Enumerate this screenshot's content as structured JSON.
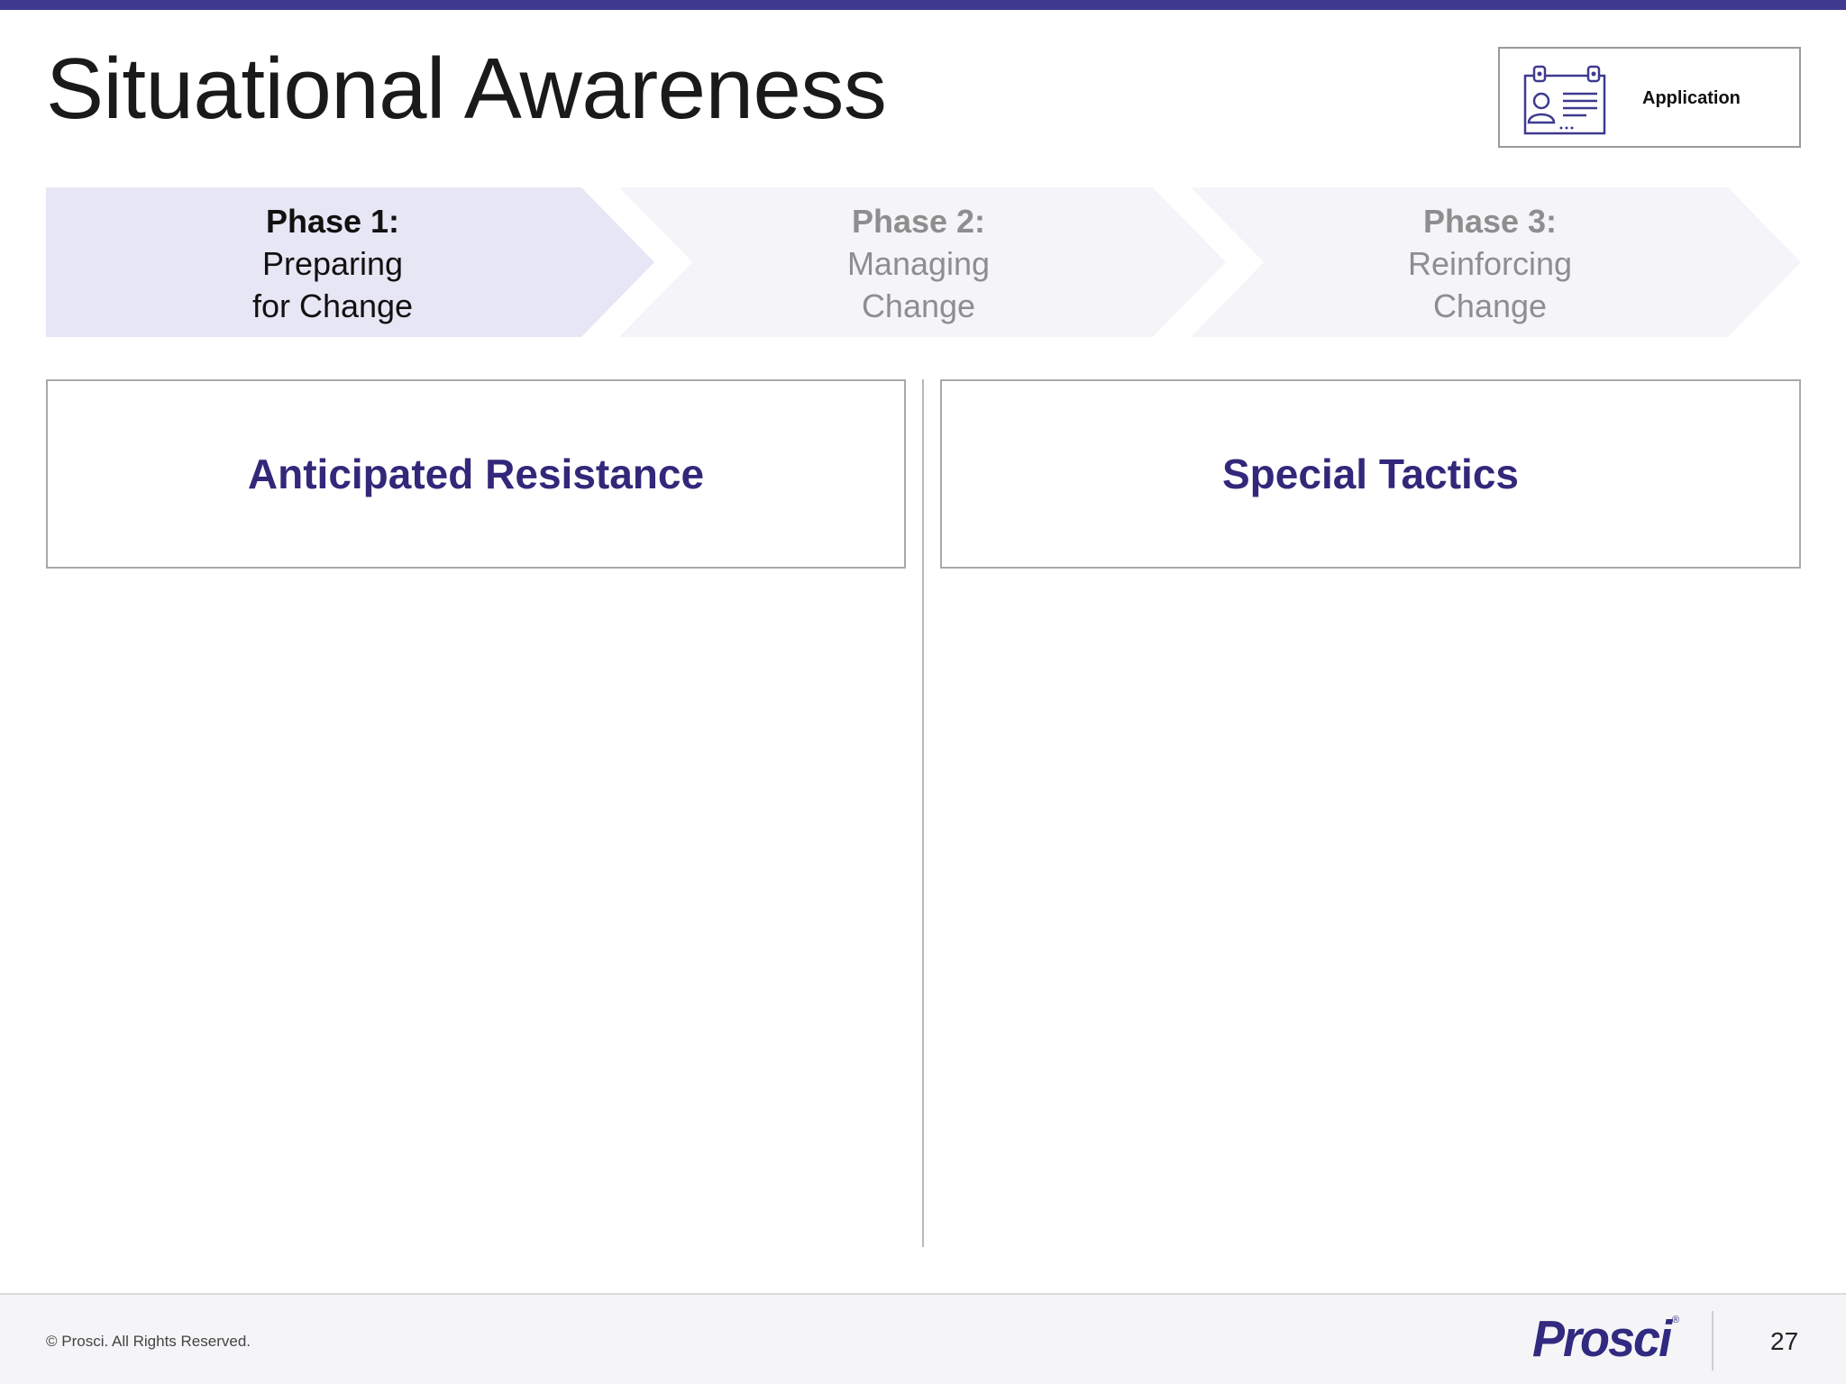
{
  "slide": {
    "title": "Situational Awareness",
    "badge": {
      "label": "Application",
      "icon": "id-card-icon"
    },
    "phases": [
      {
        "head": "Phase 1:",
        "line1": "Preparing",
        "line2": "for Change",
        "active": true
      },
      {
        "head": "Phase 2:",
        "line1": "Managing",
        "line2": "Change",
        "active": false
      },
      {
        "head": "Phase 3:",
        "line1": "Reinforcing",
        "line2": "Change",
        "active": false
      }
    ],
    "columns": {
      "left_title": "Anticipated Resistance",
      "right_title": "Special Tactics"
    }
  },
  "footer": {
    "copyright": "© Prosci. All Rights Reserved.",
    "logo": "Prosci",
    "page_number": "27"
  },
  "colors": {
    "accent": "#3d3a8f",
    "heading": "#32287a",
    "phase_active_fill": "#e7e6f5",
    "phase_inactive_fill": "#f5f5f9"
  }
}
